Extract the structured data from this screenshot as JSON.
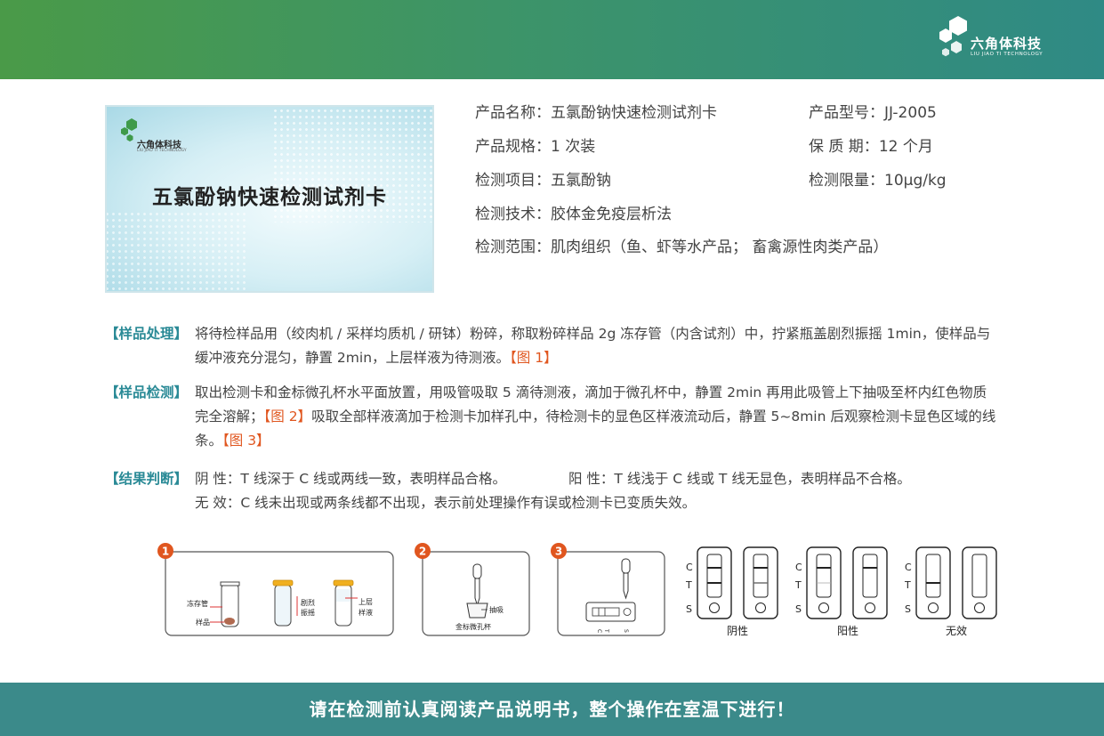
{
  "brand": {
    "name": "六角体科技",
    "tagline": "LIU JIAO TI TECHNOLOGY",
    "primary_color": "#3d9468",
    "accent_color": "#e0561f",
    "label_color": "#2a8a96"
  },
  "product_card": {
    "brand_name": "六角体科技",
    "brand_tagline": "LIU JIAO TI TECHNOLOGY",
    "title": "五氯酚钠快速检测试剂卡"
  },
  "specs": {
    "name": {
      "label": "产品名称：",
      "value": "五氯酚钠快速检测试剂卡"
    },
    "model": {
      "label": "产品型号：",
      "value": "JJ-2005"
    },
    "package": {
      "label": "产品规格：",
      "value": "1 次装"
    },
    "shelf_life": {
      "label": "保 质 期：",
      "value": "12 个月"
    },
    "item": {
      "label": "检测项目：",
      "value": "五氯酚钠"
    },
    "limit": {
      "label": "检测限量：",
      "value": "10μg/kg"
    },
    "method": {
      "label": "检测技术：",
      "value": "胶体金免疫层析法"
    },
    "scope": {
      "label": "检测范围：",
      "value": "肌肉组织（鱼、虾等水产品； 畜禽源性肉类产品）"
    }
  },
  "sections": {
    "sample_prep": {
      "label": "【样品处理】",
      "text": "将待检样品用（绞肉机 / 采样均质机 / 研钵）粉碎，称取粉碎样品 2g 冻存管（内含试剂）中，拧紧瓶盖剧烈振摇 1min，使样品与缓冲液充分混匀，静置 2min，上层样液为待测液。",
      "ref": "【图 1】"
    },
    "sample_test": {
      "label": "【样品检测】",
      "text1": "取出检测卡和金标微孔杯水平面放置，用吸管吸取 5 滴待测液，滴加于微孔杯中，静置 2min 再用此吸管上下抽吸至杯内红色物质完全溶解；",
      "ref1": "【图 2】",
      "text2": "吸取全部样液滴加于检测卡加样孔中，待检测卡的显色区样液流动后，静置 5~8min 后观察检测卡显色区域的线条。",
      "ref2": "【图 3】"
    },
    "result": {
      "label": "【结果判断】",
      "negative": "阴 性：T 线深于 C 线或两线一致，表明样品合格。",
      "positive": "阳 性：T 线浅于 C 线或 T 线无显色，表明样品不合格。",
      "invalid": "无 效：C 线未出现或两条线都不出现，表示前处理操作有误或检测卡已变质失效。"
    }
  },
  "figures": {
    "step1": {
      "number": "1",
      "tube_label": "冻存管",
      "sample_label": "样品",
      "shake_label": "剧烈振摇",
      "layer_label": "上层样液"
    },
    "step2": {
      "number": "2",
      "suction_label": "抽吸",
      "cup_label": "金标微孔杯"
    },
    "step3": {
      "number": "3",
      "c": "C",
      "t": "T",
      "s": "S"
    },
    "results": {
      "c": "C",
      "t": "T",
      "s": "S",
      "negative": "阴性",
      "positive": "阳性",
      "invalid": "无效"
    }
  },
  "footer": {
    "text": "请在检测前认真阅读产品说明书，整个操作在室温下进行！"
  }
}
